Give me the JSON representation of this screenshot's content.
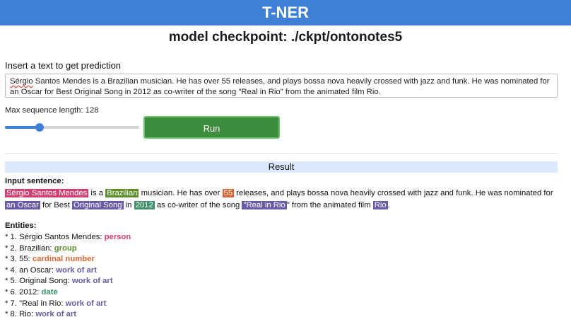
{
  "app": {
    "title": "T-NER"
  },
  "checkpoint": {
    "text": "model checkpoint: ./ckpt/ontonotes5"
  },
  "input": {
    "prompt": "Insert a text to get prediction",
    "value_spellword": "Sérgio",
    "value_rest": " Santos Mendes is a Brazilian musician. He has over 55 releases, and plays bossa nova heavily crossed with jazz and funk. He was nominated for an Oscar for Best Original Song in 2012 as co-writer of the song \"Real in Rio\" from the animated film Rio."
  },
  "settings": {
    "max_seq_label": "Max sequence length: 128",
    "max_seq_fraction": 0.26,
    "run_label": "Run"
  },
  "result": {
    "header": "Result",
    "input_label": "Input sentence:",
    "sentence": [
      {
        "text": "Sérgio Santos Mendes",
        "entity": "person"
      },
      {
        "text": " is a "
      },
      {
        "text": "Brazilian",
        "entity": "group"
      },
      {
        "text": " musician. He has over "
      },
      {
        "text": "55",
        "entity": "cardinal"
      },
      {
        "text": " releases, and plays bossa nova heavily crossed with jazz and funk. He was nominated for "
      },
      {
        "text": "an Oscar",
        "entity": "workofart"
      },
      {
        "text": " for Best "
      },
      {
        "text": "Original Song",
        "entity": "workofart"
      },
      {
        "text": " in "
      },
      {
        "text": "2012",
        "entity": "date"
      },
      {
        "text": " as co-writer of the song "
      },
      {
        "text": "\"Real in Rio",
        "entity": "workofart"
      },
      {
        "text": "\" from the animated film "
      },
      {
        "text": "Rio",
        "entity": "workofart"
      },
      {
        "text": "."
      }
    ],
    "entities_label": "Entities:",
    "entities": [
      {
        "prefix": "* 1. Sérgio Santos Mendes: ",
        "label": "person",
        "cls": "person"
      },
      {
        "prefix": "* 2. Brazilian: ",
        "label": "group",
        "cls": "group"
      },
      {
        "prefix": "* 3. 55: ",
        "label": "cardinal number",
        "cls": "cardinal"
      },
      {
        "prefix": "* 4. an Oscar: ",
        "label": "work of art",
        "cls": "workofart"
      },
      {
        "prefix": "* 5. Original Song: ",
        "label": "work of art",
        "cls": "workofart"
      },
      {
        "prefix": "* 6. 2012: ",
        "label": "date",
        "cls": "date"
      },
      {
        "prefix": "* 7. \"Real in Rio: ",
        "label": "work of art",
        "cls": "workofart"
      },
      {
        "prefix": "* 8. Rio: ",
        "label": "work of art",
        "cls": "workofart"
      }
    ]
  },
  "colors": {
    "person": "#d43f6f",
    "group": "#5d8f2b",
    "cardinal": "#d9642f",
    "work_of_art": "#6b5aa8",
    "date": "#3f8f6c",
    "header": "#3f7fd6",
    "run_button": "#3d8b3d"
  }
}
